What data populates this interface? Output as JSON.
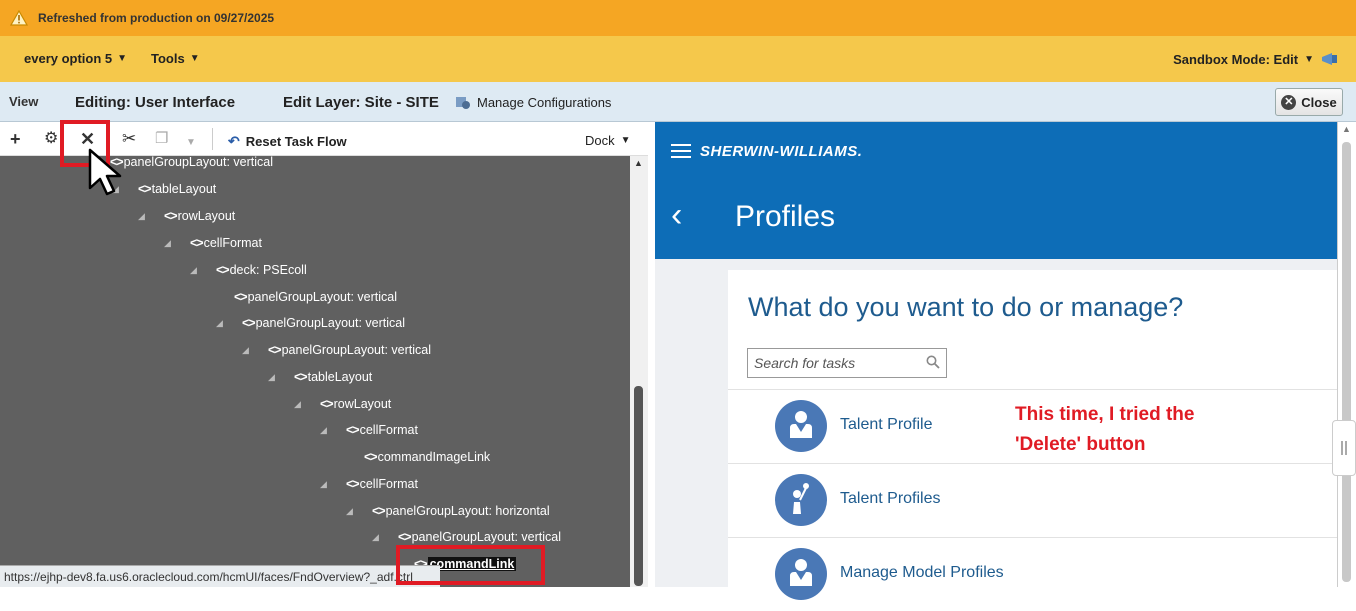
{
  "warning": {
    "text": "Refreshed from production on 09/27/2025",
    "icon": "warning-triangle-icon"
  },
  "menubar": {
    "every_option": "every option 5",
    "tools": "Tools",
    "sandbox": "Sandbox Mode: Edit"
  },
  "editbar": {
    "view": "View",
    "editing": "Editing: User Interface",
    "edit_layer": "Edit Layer: Site - SITE",
    "manage": "Manage Configurations",
    "close": "Close"
  },
  "toolbar": {
    "reset": "Reset Task Flow",
    "dock": "Dock"
  },
  "tree": {
    "nodes": [
      "panelGroupLayout: vertical",
      "tableLayout",
      "rowLayout",
      "cellFormat",
      "deck: PSEcoll",
      "panelGroupLayout: vertical",
      "panelGroupLayout: vertical",
      "panelGroupLayout: vertical",
      "tableLayout",
      "rowLayout",
      "cellFormat",
      "commandImageLink",
      "cellFormat",
      "panelGroupLayout: horizontal",
      "panelGroupLayout: vertical",
      "commandLink"
    ]
  },
  "status_url": "https://ejhp-dev8.fa.us6.oraclecloud.com/hcmUI/faces/FndOverview?_adf.ctrl",
  "app": {
    "logo": "SHERWIN-WILLIAMS.",
    "title": "Profiles",
    "question": "What do you want to do or manage?",
    "search_placeholder": "Search for tasks",
    "tasks": [
      "Talent Profile",
      "Talent Profiles",
      "Manage Model Profiles"
    ]
  },
  "annotation": {
    "line1": "This time, I tried the",
    "line2": "'Delete' button"
  },
  "colors": {
    "warning": "#f5a623",
    "menubar": "#f5c84b",
    "brand_blue": "#0d6db7",
    "annotation_red": "#e01b24"
  }
}
